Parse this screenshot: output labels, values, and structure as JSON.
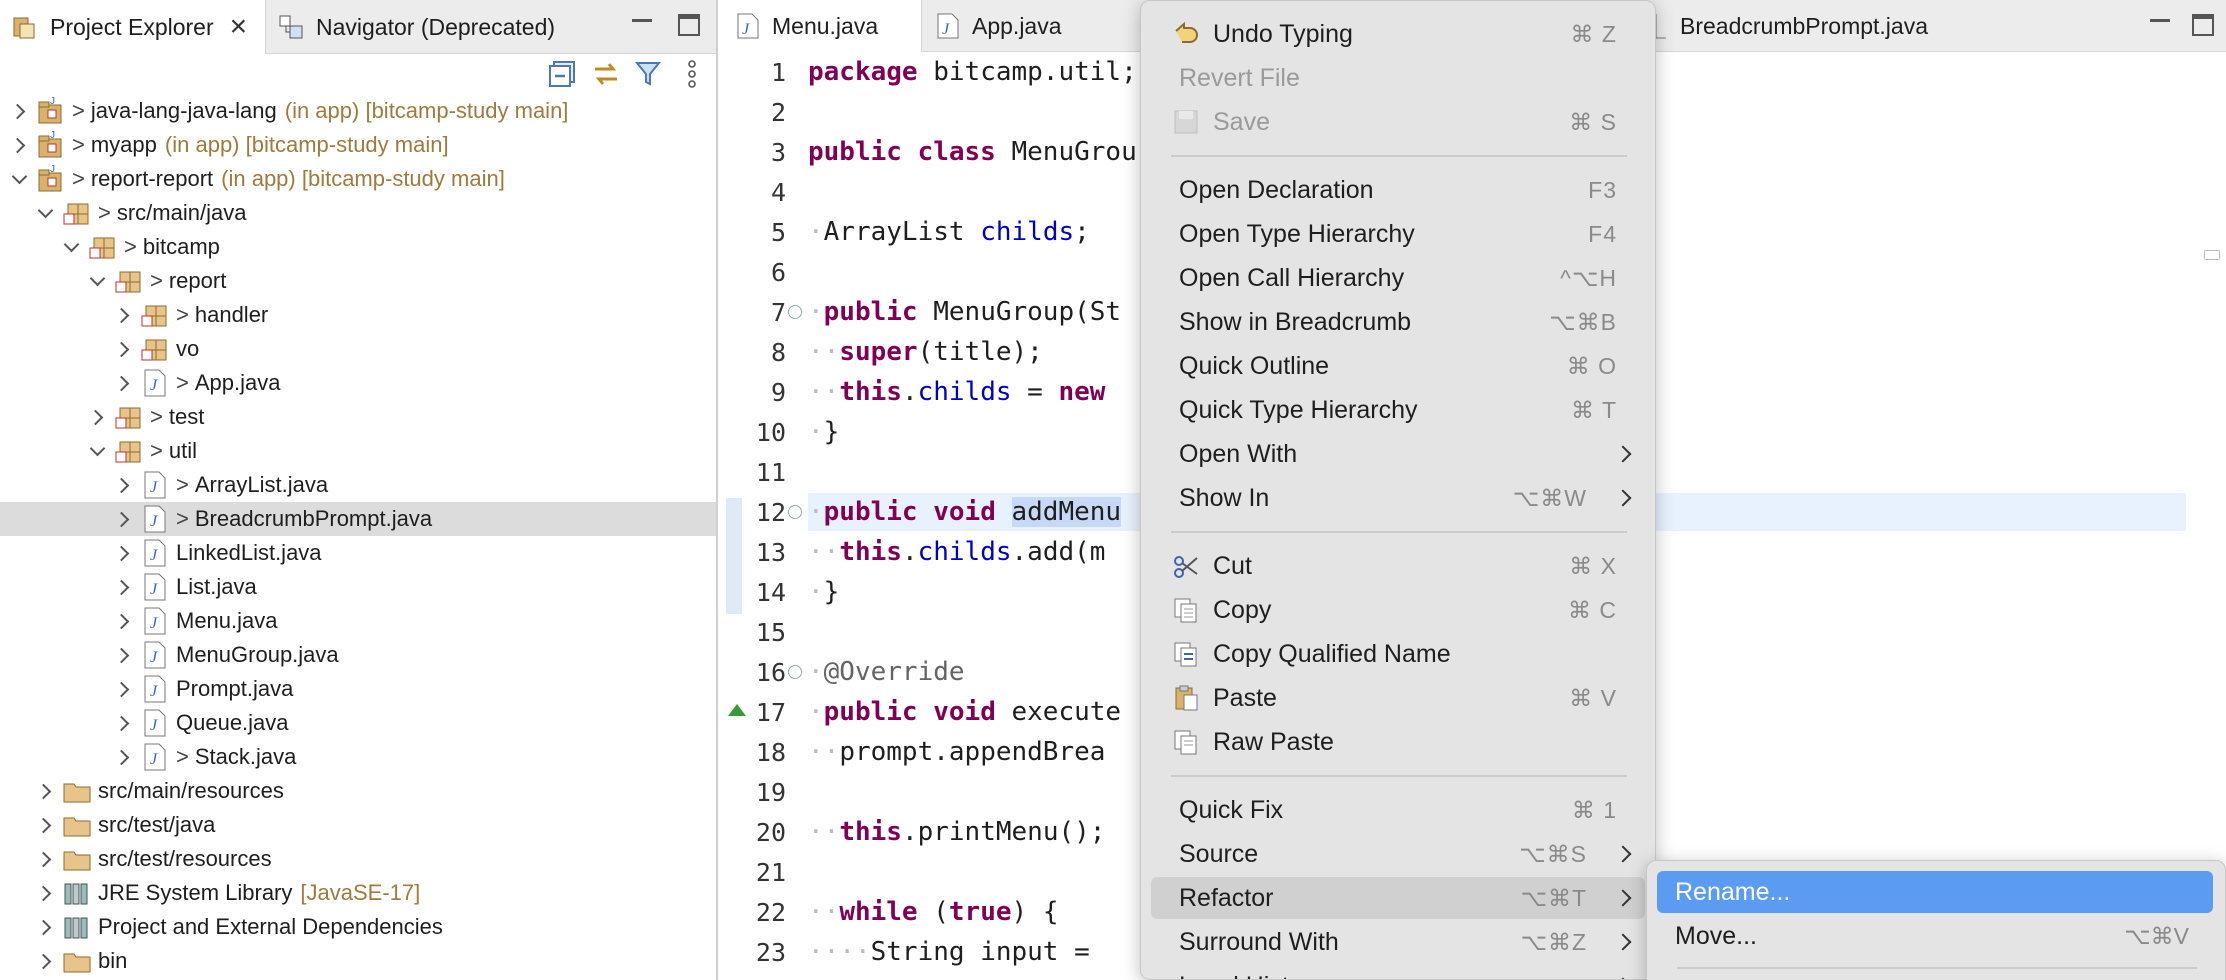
{
  "left_panel": {
    "tabs": [
      {
        "label": "Project Explorer"
      },
      {
        "label": "Navigator (Deprecated)"
      }
    ],
    "tree": [
      {
        "depth": 0,
        "chevron": "right",
        "prefix": ">",
        "label": "java-lang-java-lang",
        "extra": "(in app) [bitcamp-study main]"
      },
      {
        "depth": 0,
        "chevron": "right",
        "prefix": ">",
        "label": "myapp",
        "extra": "(in app) [bitcamp-study main]"
      },
      {
        "depth": 0,
        "chevron": "down",
        "prefix": ">",
        "label": "report-report",
        "extra": "(in app) [bitcamp-study main]"
      },
      {
        "depth": 1,
        "chevron": "down",
        "prefix": ">",
        "label": "src/main/java",
        "extra": ""
      },
      {
        "depth": 2,
        "chevron": "down",
        "prefix": ">",
        "label": "bitcamp",
        "extra": ""
      },
      {
        "depth": 3,
        "chevron": "down",
        "prefix": ">",
        "label": "report",
        "extra": ""
      },
      {
        "depth": 4,
        "chevron": "right",
        "prefix": ">",
        "label": "handler",
        "extra": ""
      },
      {
        "depth": 4,
        "chevron": "right",
        "prefix": "",
        "label": "vo",
        "extra": ""
      },
      {
        "depth": 4,
        "chevron": "right",
        "prefix": ">",
        "label": "App.java",
        "extra": ""
      },
      {
        "depth": 3,
        "chevron": "right",
        "prefix": ">",
        "label": "test",
        "extra": ""
      },
      {
        "depth": 3,
        "chevron": "down",
        "prefix": ">",
        "label": "util",
        "extra": ""
      },
      {
        "depth": 4,
        "chevron": "right",
        "prefix": ">",
        "label": "ArrayList.java",
        "extra": ""
      },
      {
        "depth": 4,
        "chevron": "right",
        "prefix": ">",
        "label": "BreadcrumbPrompt.java",
        "extra": "",
        "selected": true
      },
      {
        "depth": 4,
        "chevron": "right",
        "prefix": "",
        "label": "LinkedList.java",
        "extra": ""
      },
      {
        "depth": 4,
        "chevron": "right",
        "prefix": "",
        "label": "List.java",
        "extra": ""
      },
      {
        "depth": 4,
        "chevron": "right",
        "prefix": "",
        "label": "Menu.java",
        "extra": ""
      },
      {
        "depth": 4,
        "chevron": "right",
        "prefix": "",
        "label": "MenuGroup.java",
        "extra": ""
      },
      {
        "depth": 4,
        "chevron": "right",
        "prefix": "",
        "label": "Prompt.java",
        "extra": ""
      },
      {
        "depth": 4,
        "chevron": "right",
        "prefix": "",
        "label": "Queue.java",
        "extra": ""
      },
      {
        "depth": 4,
        "chevron": "right",
        "prefix": ">",
        "label": "Stack.java",
        "extra": ""
      },
      {
        "depth": 1,
        "chevron": "right",
        "prefix": "",
        "label": "src/main/resources",
        "extra": ""
      },
      {
        "depth": 1,
        "chevron": "right",
        "prefix": "",
        "label": "src/test/java",
        "extra": ""
      },
      {
        "depth": 1,
        "chevron": "right",
        "prefix": "",
        "label": "src/test/resources",
        "extra": ""
      },
      {
        "depth": 1,
        "chevron": "right",
        "prefix": "",
        "label": "JRE System Library",
        "extra": "[JavaSE-17]"
      },
      {
        "depth": 1,
        "chevron": "right",
        "prefix": "",
        "label": "Project and External Dependencies",
        "extra": ""
      },
      {
        "depth": 1,
        "chevron": "right",
        "prefix": "",
        "label": "bin",
        "extra": ""
      }
    ]
  },
  "editor": {
    "tabs": [
      {
        "label": "Menu.java"
      },
      {
        "label": "App.java"
      },
      {
        "label": "BreadcrumbPrompt.java"
      }
    ],
    "lines": [
      {
        "n": "1",
        "tokens": [
          [
            "kw",
            "package"
          ],
          [
            "id",
            " bitcamp.util;"
          ]
        ]
      },
      {
        "n": "2",
        "tokens": []
      },
      {
        "n": "3",
        "tokens": [
          [
            "kw",
            "public class"
          ],
          [
            "id",
            " MenuGrou"
          ]
        ]
      },
      {
        "n": "4",
        "tokens": []
      },
      {
        "n": "5",
        "tokens": [
          [
            "ind",
            "·"
          ],
          [
            "id",
            "ArrayList "
          ],
          [
            "fld",
            "childs"
          ],
          [
            "id",
            ";"
          ]
        ]
      },
      {
        "n": "6",
        "tokens": []
      },
      {
        "n": "7",
        "tokens": [
          [
            "ind",
            "·"
          ],
          [
            "kw",
            "public"
          ],
          [
            "id",
            " MenuGroup(St"
          ]
        ],
        "fold": true
      },
      {
        "n": "8",
        "tokens": [
          [
            "ind",
            "··"
          ],
          [
            "kw",
            "super"
          ],
          [
            "id",
            "(title);"
          ]
        ]
      },
      {
        "n": "9",
        "tokens": [
          [
            "ind",
            "··"
          ],
          [
            "kw",
            "this"
          ],
          [
            "id",
            "."
          ],
          [
            "fld",
            "childs"
          ],
          [
            "id",
            " = "
          ],
          [
            "kw",
            "new"
          ]
        ]
      },
      {
        "n": "10",
        "tokens": [
          [
            "ind",
            "·"
          ],
          [
            "id",
            "}"
          ]
        ]
      },
      {
        "n": "11",
        "tokens": []
      },
      {
        "n": "12",
        "tokens": [
          [
            "ind",
            "·"
          ],
          [
            "kw",
            "public void"
          ],
          [
            "id",
            " "
          ],
          [
            "sel",
            "addMenu"
          ]
        ],
        "fold": true,
        "highlight": true
      },
      {
        "n": "13",
        "tokens": [
          [
            "ind",
            "··"
          ],
          [
            "kw",
            "this"
          ],
          [
            "id",
            "."
          ],
          [
            "fld",
            "childs"
          ],
          [
            "id",
            ".add(m"
          ]
        ]
      },
      {
        "n": "14",
        "tokens": [
          [
            "ind",
            "·"
          ],
          [
            "id",
            "}"
          ]
        ]
      },
      {
        "n": "15",
        "tokens": []
      },
      {
        "n": "16",
        "tokens": [
          [
            "ind",
            "·"
          ],
          [
            "ann",
            "@Override"
          ]
        ],
        "fold": true
      },
      {
        "n": "17",
        "tokens": [
          [
            "ind",
            "·"
          ],
          [
            "kw",
            "public void"
          ],
          [
            "id",
            " execute"
          ]
        ]
      },
      {
        "n": "18",
        "tokens": [
          [
            "ind",
            "··"
          ],
          [
            "id",
            "prompt.appendBrea"
          ]
        ]
      },
      {
        "n": "19",
        "tokens": []
      },
      {
        "n": "20",
        "tokens": [
          [
            "ind",
            "··"
          ],
          [
            "kw",
            "this"
          ],
          [
            "id",
            ".printMenu();"
          ]
        ]
      },
      {
        "n": "21",
        "tokens": []
      },
      {
        "n": "22",
        "tokens": [
          [
            "ind",
            "··"
          ],
          [
            "kw",
            "while"
          ],
          [
            "id",
            " ("
          ],
          [
            "kw",
            "true"
          ],
          [
            "id",
            ") {"
          ]
        ]
      },
      {
        "n": "23",
        "tokens": [
          [
            "ind",
            "····"
          ],
          [
            "id",
            "String input = "
          ]
        ]
      }
    ]
  },
  "context_menu": {
    "items": [
      {
        "label": "Undo Typing",
        "shortcut": "⌘ Z",
        "icon": "undo-icon"
      },
      {
        "label": "Revert File",
        "shortcut": "",
        "disabled": true
      },
      {
        "label": "Save",
        "shortcut": "⌘ S",
        "icon": "save-icon",
        "disabled": true
      },
      {
        "sep": true
      },
      {
        "label": "Open Declaration",
        "shortcut": "F3"
      },
      {
        "label": "Open Type Hierarchy",
        "shortcut": "F4"
      },
      {
        "label": "Open Call Hierarchy",
        "shortcut": "^⌥H"
      },
      {
        "label": "Show in Breadcrumb",
        "shortcut": "⌥⌘B"
      },
      {
        "label": "Quick Outline",
        "shortcut": "⌘ O"
      },
      {
        "label": "Quick Type Hierarchy",
        "shortcut": "⌘ T"
      },
      {
        "label": "Open With",
        "shortcut": "",
        "submenu": true
      },
      {
        "label": "Show In",
        "shortcut": "⌥⌘W",
        "submenu": true
      },
      {
        "sep": true
      },
      {
        "label": "Cut",
        "shortcut": "⌘ X",
        "icon": "scissors-icon"
      },
      {
        "label": "Copy",
        "shortcut": "⌘ C",
        "icon": "copy-icon"
      },
      {
        "label": "Copy Qualified Name",
        "shortcut": "",
        "icon": "copy-qualified-icon"
      },
      {
        "label": "Paste",
        "shortcut": "⌘ V",
        "icon": "paste-icon"
      },
      {
        "label": "Raw Paste",
        "shortcut": "",
        "icon": "raw-paste-icon"
      },
      {
        "sep": true
      },
      {
        "label": "Quick Fix",
        "shortcut": "⌘ 1"
      },
      {
        "label": "Source",
        "shortcut": "⌥⌘S",
        "submenu": true
      },
      {
        "label": "Refactor",
        "shortcut": "⌥⌘T",
        "submenu": true,
        "active": true
      },
      {
        "label": "Surround With",
        "shortcut": "⌥⌘Z",
        "submenu": true
      },
      {
        "label": "Local History",
        "shortcut": "",
        "submenu": true
      }
    ]
  },
  "submenu": {
    "items": [
      {
        "label": "Rename...",
        "shortcut": "",
        "highlight": true
      },
      {
        "label": "Move...",
        "shortcut": "⌥⌘V"
      }
    ]
  }
}
